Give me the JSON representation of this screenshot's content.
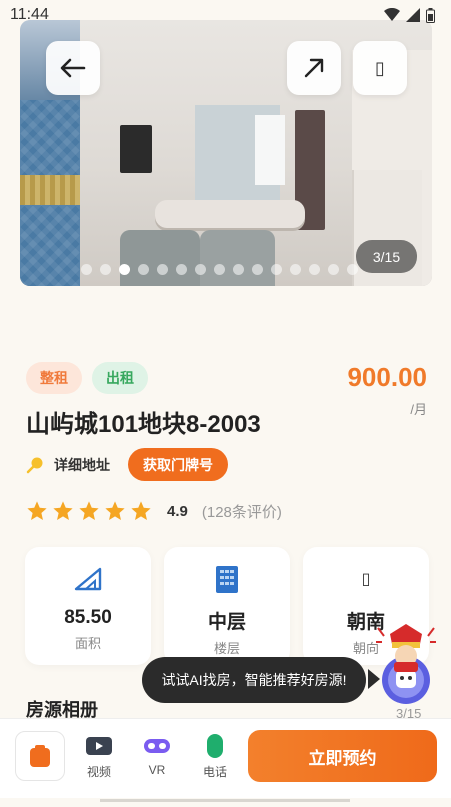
{
  "status_bar": {
    "time": "11:44"
  },
  "gallery": {
    "counter": "3/15",
    "dot_count": 15,
    "active_index": 2,
    "fav_glyph": "▯"
  },
  "listing": {
    "tags": [
      "整租",
      "出租"
    ],
    "price": "900.00",
    "price_unit": "/月",
    "title": "山屿城101地块8-2003",
    "address_label": "详细地址",
    "address_button": "获取门牌号",
    "rating_stars": 5,
    "rating_score": "4.9",
    "rating_count": "(128条评价)"
  },
  "stats": {
    "area": {
      "value": "85.50",
      "label": "面积"
    },
    "floor": {
      "value": "中层",
      "label": "楼层"
    },
    "orientation": {
      "value": "朝南",
      "label": "朝向",
      "icon_glyph": "▯"
    }
  },
  "album": {
    "title": "房源相册",
    "count": "3/15"
  },
  "ai_tip": {
    "text": "试试AI找房，智能推荐好房源!"
  },
  "bottom_nav": {
    "video_label": "视频",
    "vr_label": "VR",
    "phone_label": "电话",
    "book_label": "立即预约"
  },
  "colors": {
    "accent": "#f06d1e",
    "rent_green": "#37a85e",
    "star": "#f5a623"
  }
}
